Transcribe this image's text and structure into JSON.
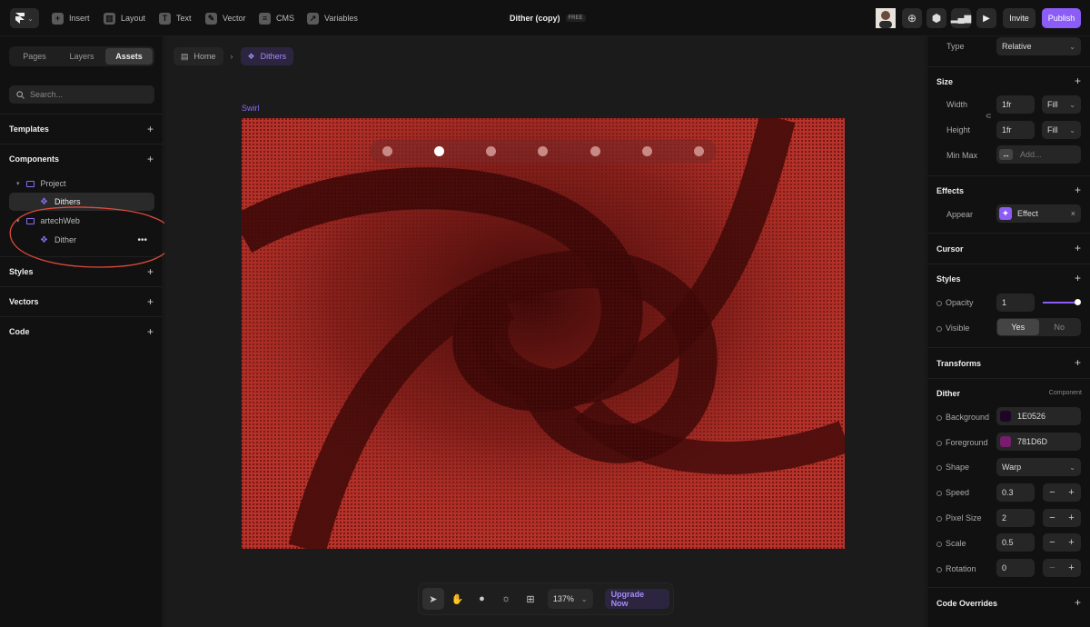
{
  "toolbar": {
    "insert": "Insert",
    "layout": "Layout",
    "text": "Text",
    "vector": "Vector",
    "cms": "CMS",
    "variables": "Variables",
    "title": "Dither (copy)",
    "plan_badge": "FREE",
    "invite": "Invite",
    "publish": "Publish",
    "accent": "#8b5cf6"
  },
  "left": {
    "tabs": [
      "Pages",
      "Layers",
      "Assets"
    ],
    "active_tab": "Assets",
    "search_placeholder": "Search...",
    "sections": {
      "templates": "Templates",
      "components": "Components",
      "styles": "Styles",
      "vectors": "Vectors",
      "code": "Code"
    },
    "tree": {
      "project": "Project",
      "dithers": "Dithers",
      "artechweb": "artechWeb",
      "dither": "Dither"
    },
    "annotation": "?"
  },
  "canvas": {
    "crumb_home": "Home",
    "crumb_current": "Dithers",
    "frame_label": "Swirl",
    "slide_count": 7,
    "active_slide": 2,
    "colors": {
      "background": "#1E0526",
      "foreground": "#781D6D"
    }
  },
  "bottom": {
    "zoom": "137%",
    "upgrade": "Upgrade Now"
  },
  "right": {
    "type_label": "Type",
    "type_value": "Relative",
    "size": "Size",
    "width_label": "Width",
    "width_value": "1fr",
    "width_mode": "Fill",
    "height_label": "Height",
    "height_value": "1fr",
    "height_mode": "Fill",
    "minmax_label": "Min Max",
    "minmax_placeholder": "Add...",
    "effects": "Effects",
    "appear_label": "Appear",
    "effect_value": "Effect",
    "cursor": "Cursor",
    "styles": "Styles",
    "opacity_label": "Opacity",
    "opacity_value": "1",
    "opacity_level": 1,
    "visible_label": "Visible",
    "visible_yes": "Yes",
    "visible_no": "No",
    "transforms": "Transforms",
    "dither": "Dither",
    "dither_tag": "Component",
    "background_label": "Background",
    "background_value": "1E0526",
    "background_color": "#1E0526",
    "foreground_label": "Foreground",
    "foreground_value": "781D6D",
    "foreground_color": "#781D6D",
    "shape_label": "Shape",
    "shape_value": "Warp",
    "speed_label": "Speed",
    "speed_value": "0.3",
    "pixel_label": "Pixel Size",
    "pixel_value": "2",
    "scale_label": "Scale",
    "scale_value": "0.5",
    "rotation_label": "Rotation",
    "rotation_value": "0",
    "code_overrides": "Code Overrides"
  }
}
